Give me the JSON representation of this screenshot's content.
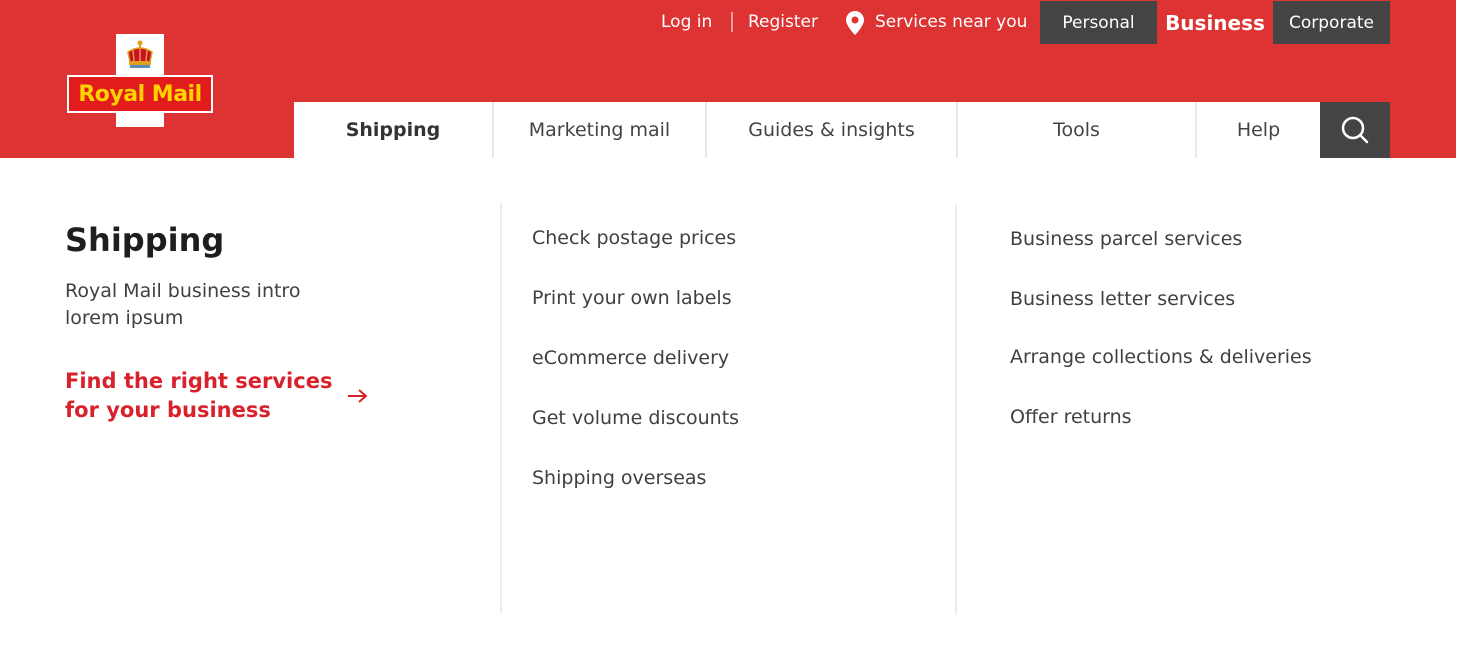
{
  "brand": {
    "logo_text": "Royal Mail",
    "colors": {
      "header_red": "#dd3333",
      "dark_grey": "#444444",
      "cta_red": "#d9212c",
      "logo_yellow": "#ffd200"
    }
  },
  "utility_nav": {
    "login": "Log in",
    "register": "Register",
    "services_near_you": "Services near you",
    "services_icon": "location-pin-icon",
    "segments": [
      {
        "label": "Personal",
        "active": false
      },
      {
        "label": "Business",
        "active": true
      },
      {
        "label": "Corporate",
        "active": false
      }
    ]
  },
  "main_nav": {
    "items": [
      {
        "label": "Shipping",
        "active": true
      },
      {
        "label": "Marketing mail",
        "active": false
      },
      {
        "label": "Guides & insights",
        "active": false
      },
      {
        "label": "Tools",
        "active": false
      },
      {
        "label": "Help",
        "active": false
      }
    ],
    "search_icon": "search-icon"
  },
  "mega_menu": {
    "title": "Shipping",
    "intro": "Royal Mail business intro lorem ipsum",
    "cta": "Find the right services for your business",
    "cta_icon": "arrow-right-icon",
    "column1": [
      "Check postage prices",
      "Print your own labels",
      "eCommerce delivery",
      "Get volume discounts",
      "Shipping overseas"
    ],
    "column2": [
      "Business parcel services",
      "Business letter services",
      "Arrange collections & deliveries",
      "Offer returns"
    ]
  }
}
